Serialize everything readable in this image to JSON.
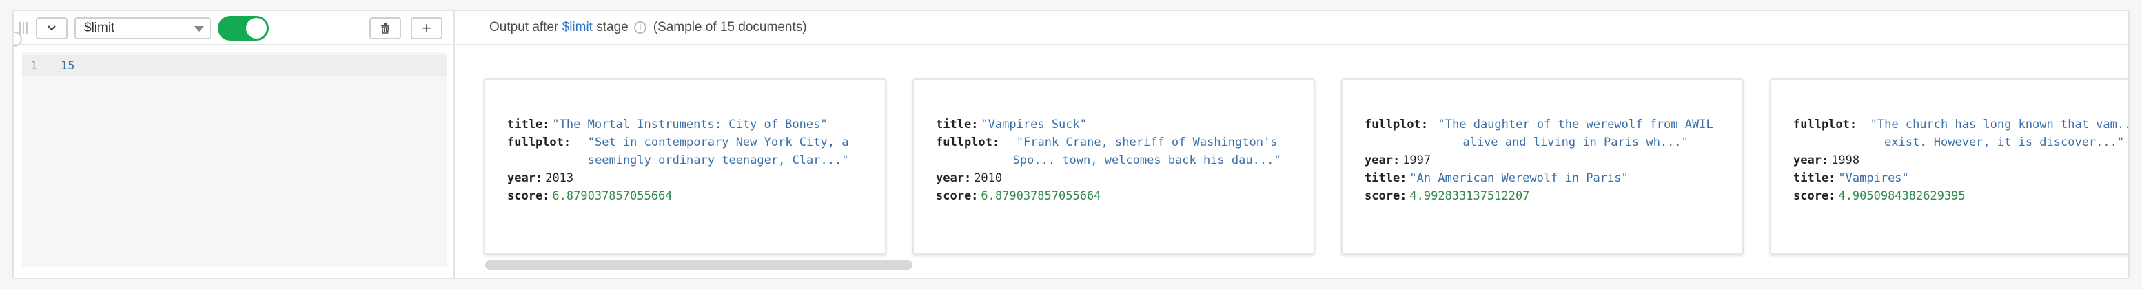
{
  "stage": {
    "operator": "$limit",
    "enabled": true,
    "code_line_number": "1",
    "code": "15",
    "add_label": "+"
  },
  "output": {
    "prefix": "Output after ",
    "stage_link": "$limit",
    "suffix": " stage",
    "info_glyph": "i",
    "sample_text": "(Sample of 15 documents)"
  },
  "documents": [
    {
      "fields": [
        {
          "key": "title:",
          "value": "\"The Mortal Instruments: City of Bones\"",
          "kind": "str"
        },
        {
          "key": "fullplot:",
          "value": "\"Set in contemporary New York City, a seemingly ordinary teenager, Clar...\"",
          "kind": "wrap"
        },
        {
          "key": "year:",
          "value": "2013",
          "kind": "num-plain"
        },
        {
          "key": "score:",
          "value": "6.879037857055664",
          "kind": "num"
        }
      ]
    },
    {
      "fields": [
        {
          "key": "title:",
          "value": "\"Vampires Suck\"",
          "kind": "str"
        },
        {
          "key": "fullplot:",
          "value": "\"Frank Crane, sheriff of Washington's Spo... town, welcomes back his dau...\"",
          "kind": "wrap"
        },
        {
          "key": "year:",
          "value": "2010",
          "kind": "num-plain"
        },
        {
          "key": "score:",
          "value": "6.879037857055664",
          "kind": "num"
        }
      ]
    },
    {
      "fields": [
        {
          "key": "fullplot:",
          "value": "\"The daughter of the werewolf from AWIL alive and living in Paris wh...\"",
          "kind": "wrap"
        },
        {
          "key": "year:",
          "value": "1997",
          "kind": "num-plain"
        },
        {
          "key": "title:",
          "value": "\"An American Werewolf in Paris\"",
          "kind": "str"
        },
        {
          "key": "score:",
          "value": "4.992833137512207",
          "kind": "num"
        }
      ]
    },
    {
      "fields": [
        {
          "key": "fullplot:",
          "value": "\"The church has long known that vam... exist. However, it is discover...\"",
          "kind": "wrap"
        },
        {
          "key": "year:",
          "value": "1998",
          "kind": "num-plain"
        },
        {
          "key": "title:",
          "value": "\"Vampires\"",
          "kind": "str"
        },
        {
          "key": "score:",
          "value": "4.9050984382629395",
          "kind": "num"
        }
      ]
    }
  ],
  "colors": {
    "toggle_on": "#13aa52",
    "string_value": "#3a6fa8",
    "number_value": "#2f8a4a",
    "link": "#2f73c4"
  },
  "icons": {
    "collapse": "chevron-down-icon",
    "delete": "trash-icon",
    "add": "plus-icon",
    "info": "info-icon",
    "drag": "drag-handle-icon"
  }
}
